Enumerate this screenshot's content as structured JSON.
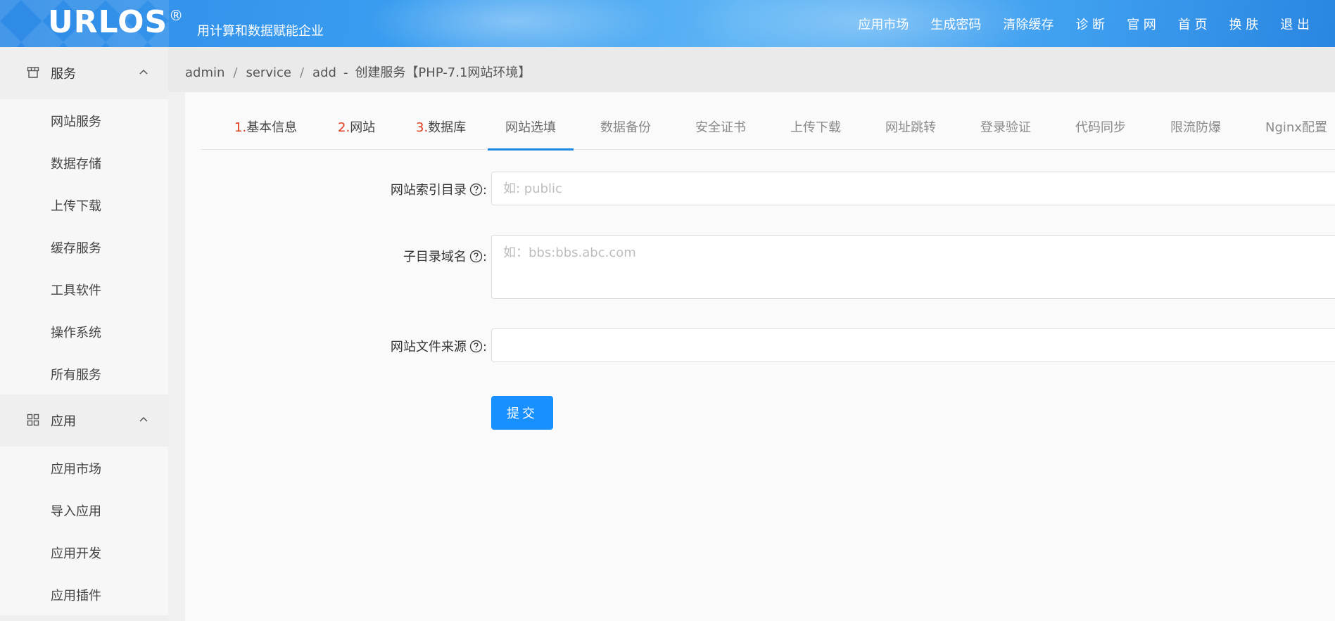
{
  "header": {
    "logo_text": "URLOS",
    "logo_mark": "®",
    "slogan": "用计算和数据赋能企业",
    "nav": [
      "应用市场",
      "生成密码",
      "清除缓存",
      "诊 断",
      "官 网",
      "首 页",
      "换 肤",
      "退 出"
    ]
  },
  "sidebar": {
    "groups": [
      {
        "label": "服务",
        "icon": "shop-icon",
        "items": [
          "网站服务",
          "数据存储",
          "上传下载",
          "缓存服务",
          "工具软件",
          "操作系统",
          "所有服务"
        ]
      },
      {
        "label": "应用",
        "icon": "grid-icon",
        "items": [
          "应用市场",
          "导入应用",
          "应用开发",
          "应用插件"
        ]
      }
    ]
  },
  "breadcrumb": {
    "parts": [
      "admin",
      "service",
      "add"
    ],
    "title": "创建服务【PHP-7.1网站环境】"
  },
  "tabs": [
    {
      "num": "1.",
      "label": "基本信息"
    },
    {
      "num": "2.",
      "label": "网站"
    },
    {
      "num": "3.",
      "label": "数据库"
    },
    {
      "num": "",
      "label": "网站选填"
    },
    {
      "num": "",
      "label": "数据备份"
    },
    {
      "num": "",
      "label": "安全证书"
    },
    {
      "num": "",
      "label": "上传下载"
    },
    {
      "num": "",
      "label": "网址跳转"
    },
    {
      "num": "",
      "label": "登录验证"
    },
    {
      "num": "",
      "label": "代码同步"
    },
    {
      "num": "",
      "label": "限流防爆"
    },
    {
      "num": "",
      "label": "Nginx配置"
    }
  ],
  "form": {
    "index_dir": {
      "label": "网站索引目录",
      "colon": ":",
      "value": "",
      "placeholder": "如: public"
    },
    "subdomain": {
      "label": "子目录域名",
      "colon": ":",
      "value": "",
      "placeholder": "如：bbs:bbs.abc.com"
    },
    "source": {
      "label": "网站文件来源",
      "colon": ":",
      "value": "",
      "placeholder": ""
    },
    "submit_label": "提交"
  }
}
